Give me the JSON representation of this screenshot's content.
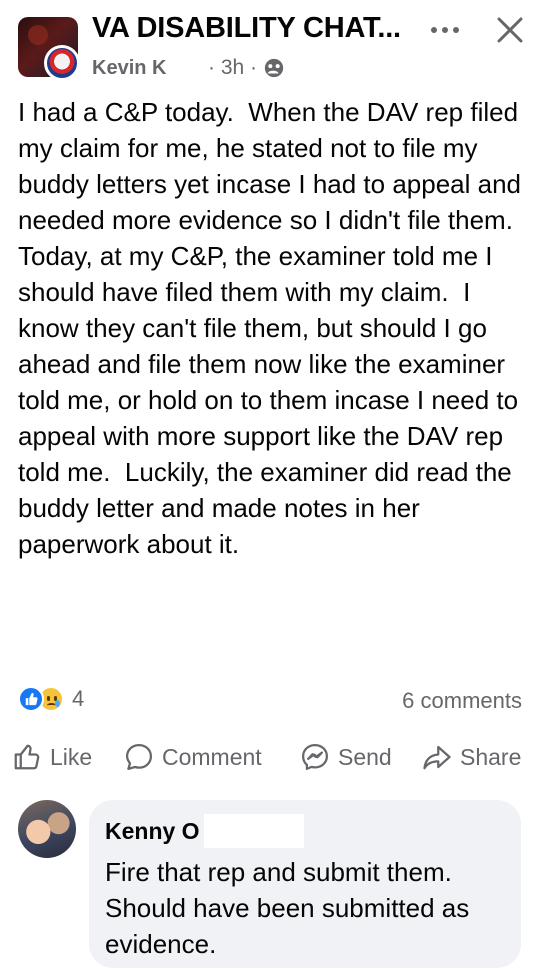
{
  "header": {
    "group_name": "VA DISABILITY CHAT...",
    "author": "Kevin K",
    "time": "· 3h ·",
    "privacy_icon": "group-globe-icon"
  },
  "post": {
    "text": "I had a C&P today.  When the DAV rep filed my claim for me, he stated not to file my buddy letters yet incase I had to appeal and needed more evidence so I didn't file them. Today, at my C&P, the examiner told me I should have filed them with my claim.  I know they can't file them, but should I go ahead and file them now like the examiner told me, or hold on to them incase I need to appeal with more support like the DAV rep told me.  Luckily, the examiner did read the buddy letter and made notes in her paperwork about it."
  },
  "stats": {
    "reaction_count": "4",
    "comments": "6 comments"
  },
  "actions": {
    "like": "Like",
    "comment": "Comment",
    "send": "Send",
    "share": "Share"
  },
  "comment": {
    "author": "Kenny O",
    "text": "Fire that rep and submit them.  Should have been submitted as evidence."
  },
  "colors": {
    "text": "#050505",
    "secondary": "#65676b",
    "like_blue": "#1877f2",
    "bubble": "#f0f2f5"
  }
}
